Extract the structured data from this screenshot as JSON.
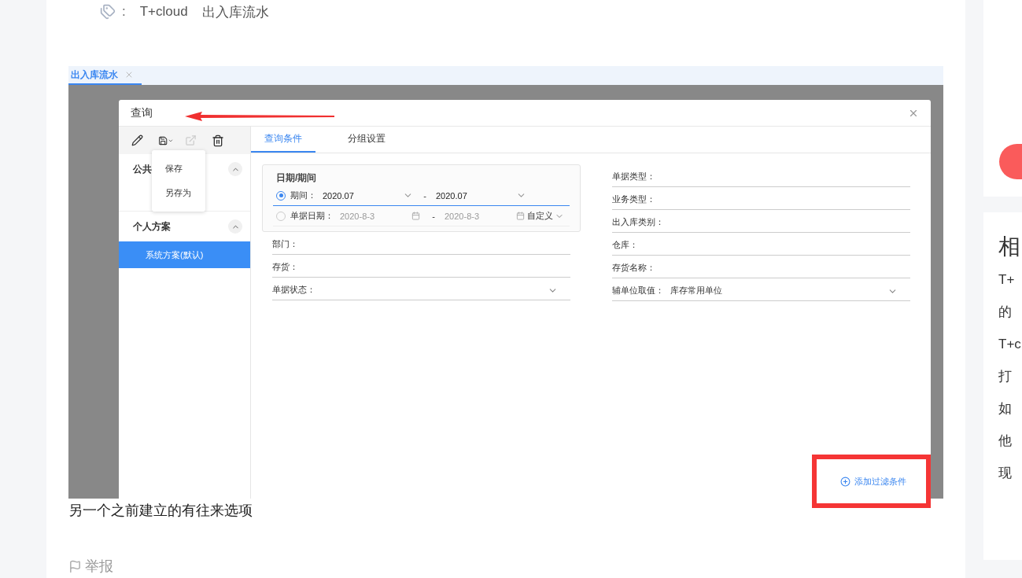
{
  "tags": {
    "separator": ":",
    "items": [
      "T+cloud",
      "出入库流水"
    ]
  },
  "screenshot": {
    "tab": {
      "label": "出入库流水",
      "selected": true
    },
    "dialog": {
      "title": "查询",
      "toolbar": [
        {
          "kind": "edit",
          "disabled": false
        },
        {
          "kind": "save",
          "disabled": false
        },
        {
          "kind": "export",
          "disabled": true
        },
        {
          "kind": "delete",
          "disabled": false
        }
      ],
      "save_menu": [
        "保存",
        "另存为"
      ],
      "scheme_groups": [
        {
          "label": "公共",
          "expanded": true
        },
        {
          "label": "个人方案",
          "expanded": true,
          "items": [
            {
              "label": "系统方案(默认)",
              "selected": true
            }
          ]
        }
      ],
      "tabs": [
        {
          "label": "查询条件",
          "selected": true
        },
        {
          "label": "分组设置",
          "selected": false
        }
      ],
      "date_group": {
        "title": "日期/期间",
        "rows": [
          {
            "kind": "period",
            "label": "期间：",
            "selected": true,
            "from": "2020.07",
            "separator": "-",
            "to": "2020.07"
          },
          {
            "kind": "date",
            "label": "单据日期：",
            "selected": false,
            "from": "2020-8-3",
            "separator": "-",
            "to": "2020-8-3",
            "range": "自定义"
          }
        ]
      },
      "left_fields": [
        {
          "kind": "text",
          "label": "部门："
        },
        {
          "kind": "text",
          "label": "存货："
        },
        {
          "kind": "select",
          "label": "单据状态："
        }
      ],
      "right_fields": [
        {
          "kind": "text",
          "label": "单据类型："
        },
        {
          "kind": "text",
          "label": "业务类型："
        },
        {
          "kind": "text",
          "label": "出入库类别："
        },
        {
          "kind": "text",
          "label": "仓库："
        },
        {
          "kind": "text",
          "label": "存货名称："
        },
        {
          "kind": "select",
          "label": "辅单位取值：",
          "value": "库存常用单位"
        }
      ],
      "add_filter": "添加过滤条件"
    }
  },
  "caption": "另一个之前建立的有往来选项",
  "report": "举报",
  "sidebar": {
    "related_title": "相",
    "related_items": [
      "T+",
      "的",
      "T+c",
      "打",
      "如",
      "他",
      "现"
    ]
  }
}
